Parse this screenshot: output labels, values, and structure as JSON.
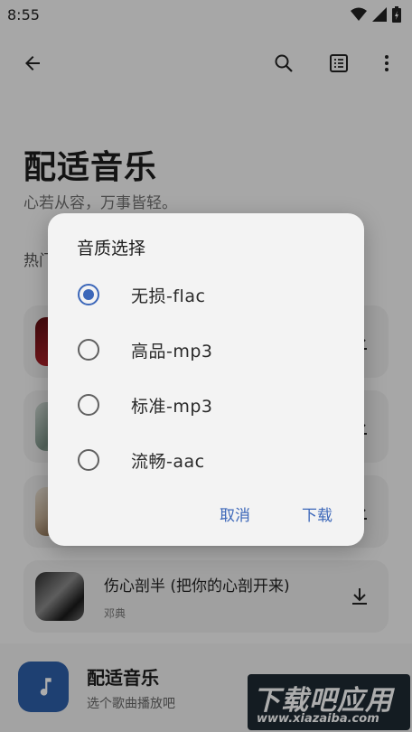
{
  "status_bar": {
    "time": "8:55"
  },
  "header": {
    "title": "配适音乐",
    "subtitle": "心若从容，万事皆轻。",
    "section_label": "热门"
  },
  "songs": [
    {
      "title": "",
      "artist": ""
    },
    {
      "title": "",
      "artist": ""
    },
    {
      "title": "",
      "artist": ""
    },
    {
      "title": "伤心剖半 (把你的心剖开来)",
      "artist": "邓典"
    }
  ],
  "player": {
    "title": "配适音乐",
    "subtitle": "选个歌曲播放吧"
  },
  "dialog": {
    "title": "音质选择",
    "options": [
      {
        "label": "无损-flac",
        "selected": true
      },
      {
        "label": "高品-mp3",
        "selected": false
      },
      {
        "label": "标准-mp3",
        "selected": false
      },
      {
        "label": "流畅-aac",
        "selected": false
      }
    ],
    "cancel_label": "取消",
    "confirm_label": "下载"
  },
  "watermark": {
    "text": "下载吧应用",
    "url": "www.xiazaiba.com"
  },
  "colors": {
    "accent": "#3c67b9",
    "player_art": "#2d5fa8"
  }
}
